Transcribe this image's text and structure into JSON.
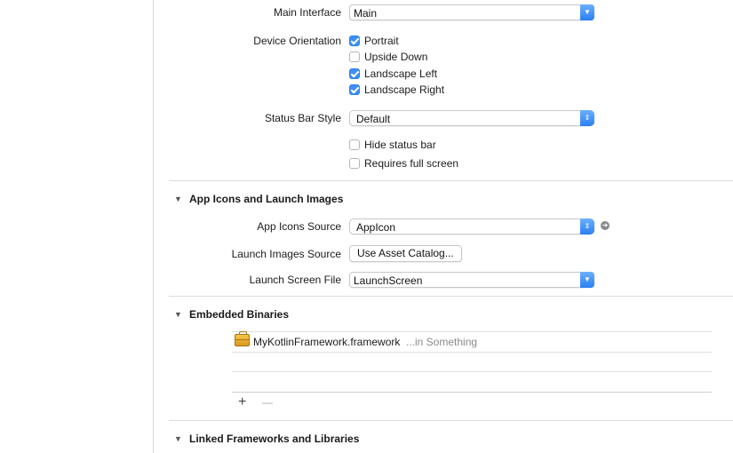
{
  "deployment_info": {
    "main_interface": {
      "label": "Main Interface",
      "value": "Main"
    },
    "device_orientation": {
      "label": "Device Orientation",
      "options": [
        {
          "label": "Portrait",
          "checked": true
        },
        {
          "label": "Upside Down",
          "checked": false
        },
        {
          "label": "Landscape Left",
          "checked": true
        },
        {
          "label": "Landscape Right",
          "checked": true
        }
      ]
    },
    "status_bar_style": {
      "label": "Status Bar Style",
      "value": "Default"
    },
    "hide_status_bar": {
      "label": "Hide status bar",
      "checked": false
    },
    "requires_full_screen": {
      "label": "Requires full screen",
      "checked": false
    }
  },
  "app_icons": {
    "title": "App Icons and Launch Images",
    "icons_source": {
      "label": "App Icons Source",
      "value": "AppIcon"
    },
    "launch_images_source": {
      "label": "Launch Images Source",
      "button": "Use Asset Catalog..."
    },
    "launch_screen_file": {
      "label": "Launch Screen File",
      "value": "LaunchScreen"
    }
  },
  "embedded_binaries": {
    "title": "Embedded Binaries",
    "items": [
      {
        "name": "MyKotlinFramework.framework",
        "location": "...in Something"
      }
    ],
    "add_label": "+",
    "remove_label": "—"
  },
  "linked_frameworks": {
    "title": "Linked Frameworks and Libraries"
  },
  "colors": {
    "accent": "#3d8ff5",
    "divider": "#dcdcdc"
  },
  "icons": {
    "disclosure": "disclosure-triangle-icon",
    "popup_arrow": "chevron-down-icon",
    "go": "go-arrow-icon",
    "framework": "toolbox-icon"
  }
}
